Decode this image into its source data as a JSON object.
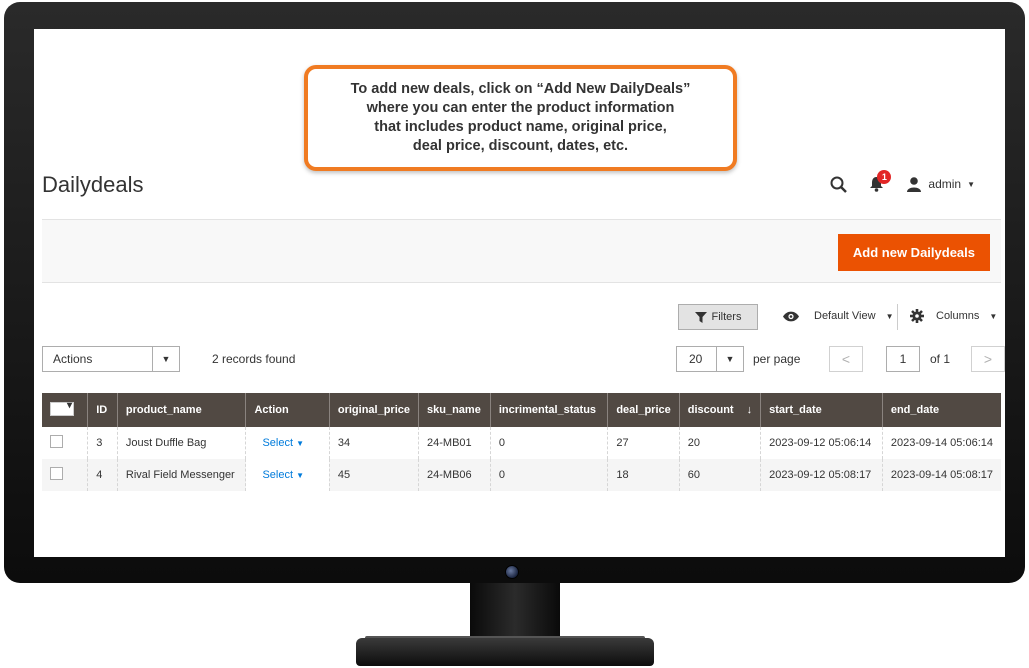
{
  "callout": {
    "lines": [
      "To add new deals, click on “Add New DailyDeals”",
      "where you can enter the product information",
      "that includes product name, original price,",
      "deal price, discount, dates, etc."
    ]
  },
  "header": {
    "title": "Dailydeals",
    "notification_count": "1",
    "user": "admin"
  },
  "toolbar": {
    "add_button_label": "Add new Dailydeals",
    "filters_label": "Filters",
    "view_label": "Default View",
    "columns_label": "Columns"
  },
  "grid_controls": {
    "actions_value": "Actions",
    "records_found": "2 records found",
    "per_page_value": "20",
    "per_page_label": "per page",
    "current_page": "1",
    "total_pages": "of 1",
    "prev_symbol": "<",
    "next_symbol": ">"
  },
  "table": {
    "columns": [
      "ID",
      "product_name",
      "Action",
      "original_price",
      "sku_name",
      "incrimental_status",
      "deal_price",
      "discount",
      "start_date",
      "end_date"
    ],
    "sort_indicator": "↓",
    "rows": [
      {
        "id": "3",
        "product_name": "Joust Duffle Bag",
        "action": "Select",
        "original_price": "34",
        "sku_name": "24-MB01",
        "incrimental_status": "0",
        "deal_price": "27",
        "discount": "20",
        "start_date": "2023-09-12 05:06:14",
        "end_date": "2023-09-14 05:06:14"
      },
      {
        "id": "4",
        "product_name": "Rival Field Messenger",
        "action": "Select",
        "original_price": "45",
        "sku_name": "24-MB06",
        "incrimental_status": "0",
        "deal_price": "18",
        "discount": "60",
        "start_date": "2023-09-12 05:08:17",
        "end_date": "2023-09-14 05:08:17"
      }
    ]
  },
  "colors": {
    "accent": "#eb5202",
    "callout_border": "#f07b22",
    "table_header": "#514943",
    "link": "#007bdb",
    "badge": "#e22626"
  },
  "icons": [
    "search-icon",
    "bell-icon",
    "user-icon",
    "filter-icon",
    "eye-icon",
    "gear-icon",
    "chevron-down-icon"
  ]
}
